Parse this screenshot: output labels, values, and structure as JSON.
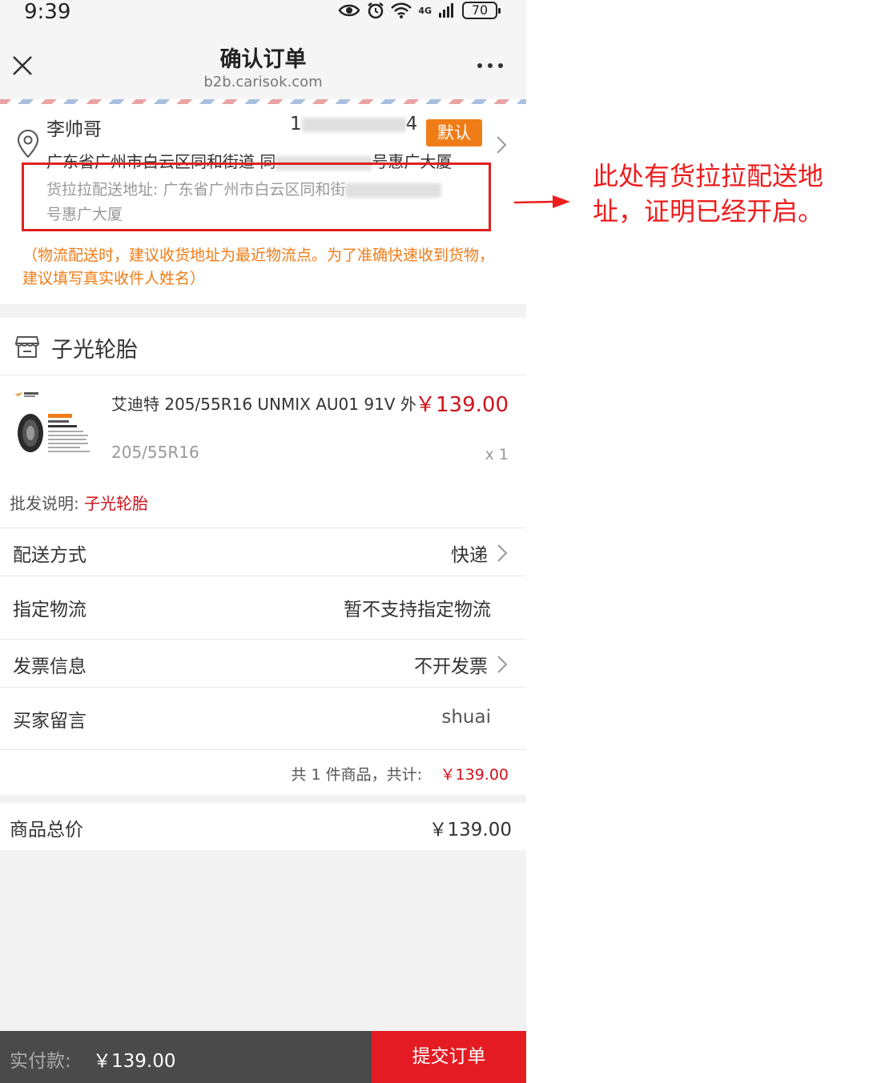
{
  "status_bar": {
    "time": "9:39",
    "network": "4G",
    "battery": "70"
  },
  "nav": {
    "title": "确认订单",
    "domain": "b2b.carisok.com"
  },
  "address": {
    "name": "李帅哥",
    "phone_prefix": "1",
    "phone_suffix": "4",
    "default_badge": "默认",
    "line_prefix": "广东省广州市白云区同和街道 同",
    "line_suffix": "号惠广大厦",
    "huolala_prefix": "货拉拉配送地址: 广东省广州市白云区同和街",
    "huolala_suffix": "号惠广大厦",
    "tip": "（物流配送时，建议收货地址为最近物流点。为了准确快速收到货物，建议填写真实收件人姓名）"
  },
  "shop": {
    "name": "子光轮胎",
    "product": {
      "title": "艾迪特 205/55R16 UNMIX AU01 91V 外",
      "price": "￥139.00",
      "spec": "205/55R16",
      "quantity": "x 1"
    },
    "wholesale_label": "批发说明:",
    "wholesale_value": "子光轮胎"
  },
  "rows": {
    "delivery": {
      "label": "配送方式",
      "value": "快递"
    },
    "logistics": {
      "label": "指定物流",
      "value": "暂不支持指定物流"
    },
    "invoice": {
      "label": "发票信息",
      "value": "不开发票"
    },
    "message": {
      "label": "买家留言",
      "value": "shuai"
    }
  },
  "subtotal": {
    "label": "共 1 件商品，共计:",
    "value": "￥139.00"
  },
  "total": {
    "label": "商品总价",
    "value": "￥139.00"
  },
  "footer": {
    "pay_label": "实付款:",
    "pay_value": "￥139.00",
    "submit": "提交订单"
  },
  "annotation": {
    "text": "此处有货拉拉配送地址，证明已经开启。"
  },
  "colors": {
    "accent_red": "#e41b23",
    "price_red": "#d0121b",
    "badge_orange": "#f07c17",
    "annotation_red": "#ee1c1c"
  }
}
